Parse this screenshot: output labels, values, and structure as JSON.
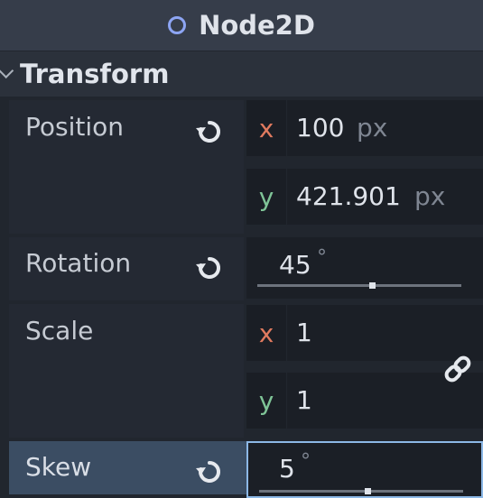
{
  "header": {
    "title": "Node2D",
    "icon": "node2d-circle-icon",
    "accent": "#8da5f3"
  },
  "section": {
    "title": "Transform"
  },
  "properties": {
    "position": {
      "label": "Position",
      "x_axis": "x",
      "x_value": "100",
      "x_unit": "px",
      "y_axis": "y",
      "y_value": "421.901",
      "y_unit": "px"
    },
    "rotation": {
      "label": "Rotation",
      "value": "45",
      "unit": "°",
      "slider_fraction": 0.56
    },
    "scale": {
      "label": "Scale",
      "x_axis": "x",
      "x_value": "1",
      "y_axis": "y",
      "y_value": "1"
    },
    "skew": {
      "label": "Skew",
      "value": "5",
      "unit": "°",
      "slider_fraction": 0.53
    }
  },
  "colors": {
    "x_axis": "#e07a5f",
    "y_axis": "#7fc497",
    "focus_border": "#8cb8e6",
    "selected_row": "#3b4d63"
  }
}
